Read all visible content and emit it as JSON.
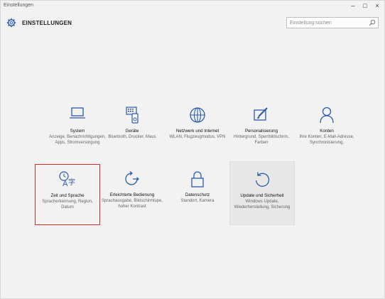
{
  "window": {
    "title": "Einstellungen",
    "minimize_glyph": "–",
    "maximize_glyph": "□",
    "close_glyph": "×"
  },
  "header": {
    "title": "EINSTELLUNGEN",
    "icon": "gear-icon"
  },
  "search": {
    "placeholder": "Einstellung suchen",
    "value": "",
    "icon": "search-icon"
  },
  "accent_color": "#2b5aa8",
  "selection_color": "#d42a2a",
  "tiles": [
    {
      "id": "system",
      "label": "System",
      "description": "Anzeige, Benachrichtigungen, Apps, Stromversorgung",
      "icon": "laptop-icon"
    },
    {
      "id": "geraete",
      "label": "Geräte",
      "description": "Bluetooth, Drucker, Maus",
      "icon": "devices-icon"
    },
    {
      "id": "netzwerk",
      "label": "Netzwerk und Internet",
      "description": "WLAN, Flugzeugmodus, VPN",
      "icon": "globe-icon"
    },
    {
      "id": "personalisierung",
      "label": "Personalisierung",
      "description": "Hintergrund, Sperrbildschirm, Farben",
      "icon": "paint-icon"
    },
    {
      "id": "konten",
      "label": "Konten",
      "description": "Ihre Konten, E-Mail-Adresse, Synchronisierung,",
      "icon": "person-icon"
    },
    {
      "id": "zeit",
      "label": "Zeit und Sprache",
      "description": "Spracherkennung, Region, Datum",
      "icon": "time-language-icon",
      "selected": true
    },
    {
      "id": "erleichterte",
      "label": "Erleichterte Bedienung",
      "description": "Sprachausgabe, Bildschirmlupe, hoher Kontrast",
      "icon": "ease-of-access-icon"
    },
    {
      "id": "datenschutz",
      "label": "Datenschutz",
      "description": "Standort, Kamera",
      "icon": "lock-icon"
    },
    {
      "id": "update",
      "label": "Update und Sicherheit",
      "description": "Windows Update, Wiederherstellung, Sicherung",
      "icon": "refresh-icon",
      "hover": true
    }
  ]
}
